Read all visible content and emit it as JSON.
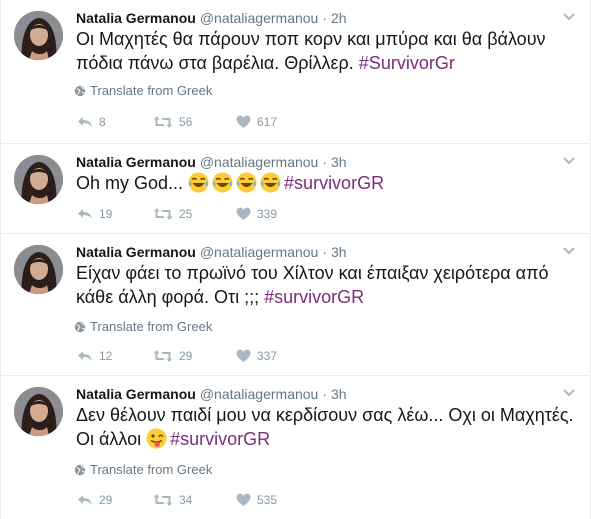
{
  "colors": {
    "hashtag": "#7c2d7e",
    "meta": "#657786",
    "action": "#8899a6",
    "divider": "#e6ecf0"
  },
  "tweets": [
    {
      "name": "Natalia Germanou",
      "handle": "@nataliagermanou",
      "separator": "·",
      "time": "2h",
      "text": "Οι Μαχητές θα πάρουν ποπ κορν και μπύρα και θα βάλουν πόδια πάνω στα βαρέλια. Θρίλλερ. ",
      "hashtag": "#SurvivorGr",
      "translate": "Translate from Greek",
      "replies": "8",
      "retweets": "56",
      "likes": "617"
    },
    {
      "name": "Natalia Germanou",
      "handle": "@nataliagermanou",
      "separator": "·",
      "time": "3h",
      "text": "Oh my God... ",
      "emojis": [
        "face-with-tears-of-joy-icon",
        "face-with-tears-of-joy-icon",
        "face-with-tears-of-joy-icon",
        "face-with-tears-of-joy-icon"
      ],
      "hashtag": "#survivorGR",
      "replies": "19",
      "retweets": "25",
      "likes": "339"
    },
    {
      "name": "Natalia Germanou",
      "handle": "@nataliagermanou",
      "separator": "·",
      "time": "3h",
      "text": "Είχαν φάει το πρωϊνό του Χίλτον και έπαιξαν χειρότερα από κάθε άλλη φορά. Οτι ;;; ",
      "hashtag": "#survivorGR",
      "translate": "Translate from Greek",
      "replies": "12",
      "retweets": "29",
      "likes": "337"
    },
    {
      "name": "Natalia Germanou",
      "handle": "@nataliagermanou",
      "separator": "·",
      "time": "3h",
      "text": "Δεν θέλουν παιδί μου να κερδίσουν σας λέω... Οχι οι Μαχητές. Οι άλλοι ",
      "emojis": [
        "winking-face-with-tongue-icon"
      ],
      "hashtag": "#survivorGR",
      "translate": "Translate from Greek",
      "replies": "29",
      "retweets": "34",
      "likes": "535"
    }
  ]
}
